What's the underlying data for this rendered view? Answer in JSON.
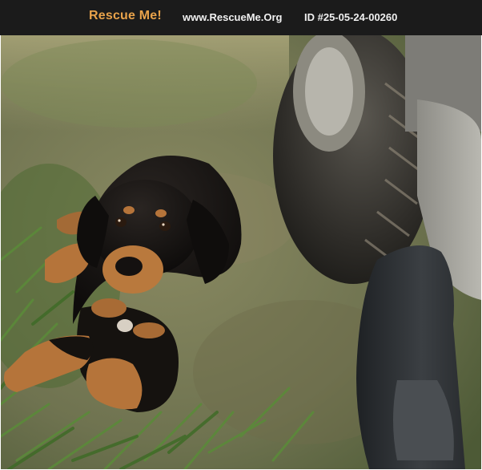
{
  "header": {
    "brand": "Rescue Me!",
    "site": "www.RescueMe.Org",
    "listing_id": "ID #25-05-24-00260"
  },
  "colors": {
    "header_bg": "#1b1b1b",
    "brand": "#e8a24a",
    "header_text": "#f0f0f0"
  }
}
